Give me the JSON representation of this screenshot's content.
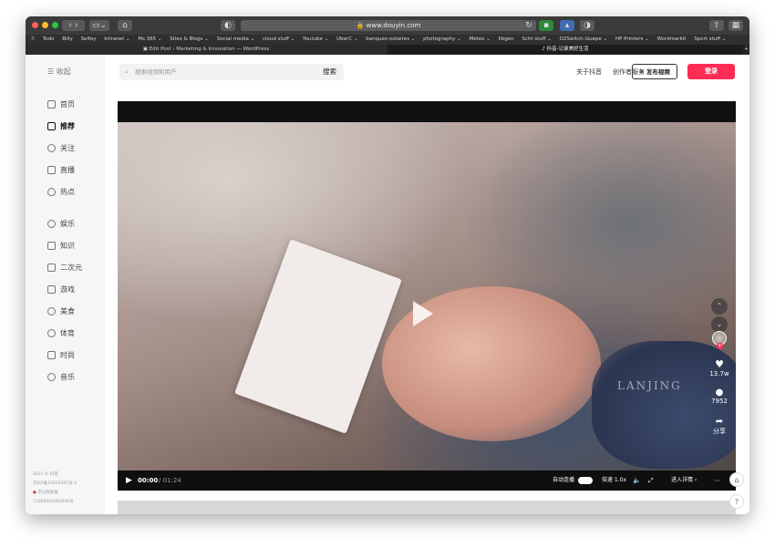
{
  "browser": {
    "url": "www.douyin.com",
    "bookmarks": [
      "Todo",
      "Billy",
      "Selfey",
      "Intranet ⌄",
      "Ms 365 ⌄",
      "Sites & Blogs ⌄",
      "Social media ⌄",
      "cloud stuff ⌄",
      "Youtube ⌄",
      "UberC ⌄",
      "banques-notaires ⌄",
      "photography ⌄",
      "Meteo ⌄",
      "libgen",
      "Scht stuff ⌄",
      "O2Switch-Guepe ⌄",
      "HP Printers ⌄",
      "Wordmarkit",
      "Sport stuff ⌄"
    ],
    "tabs": [
      {
        "label": "Edit Post ‹ Marketing & Innovation — WordPress"
      },
      {
        "label": "抖音-记录美好生活"
      }
    ]
  },
  "sidebar": {
    "collapse_label": "收起",
    "items": [
      {
        "label": "首页",
        "icon": "home-icon"
      },
      {
        "label": "推荐",
        "icon": "thumbs-up-icon",
        "active": true
      },
      {
        "label": "关注",
        "icon": "user-icon"
      },
      {
        "label": "直播",
        "icon": "live-icon"
      },
      {
        "label": "热点",
        "icon": "flame-icon"
      },
      {
        "label": "娱乐",
        "icon": "entertainment-icon"
      },
      {
        "label": "知识",
        "icon": "book-icon"
      },
      {
        "label": "二次元",
        "icon": "tv-icon"
      },
      {
        "label": "游戏",
        "icon": "gamepad-icon"
      },
      {
        "label": "美食",
        "icon": "food-icon"
      },
      {
        "label": "体育",
        "icon": "sports-icon"
      },
      {
        "label": "时尚",
        "icon": "shirt-icon"
      },
      {
        "label": "音乐",
        "icon": "music-icon"
      }
    ],
    "footer": [
      "2021 © 抖音",
      "京ICP备16016397号-3",
      "京公网安备",
      "11000002002046号"
    ]
  },
  "header": {
    "search_placeholder": "搜索视频和用户",
    "search_button": "搜索",
    "about": "关于抖音",
    "creator": "创作者服务",
    "upload": "+ 发布视频",
    "login": "登录"
  },
  "video": {
    "watermark": "LANJING",
    "time_current": "00:00",
    "time_total": "/ 01:24",
    "autoplay_label": "自动连播",
    "speed_label": "倍速 1.0x",
    "details_label": "进入详情 ›",
    "likes": "13.7w",
    "comments": "7952",
    "share": "分享"
  }
}
